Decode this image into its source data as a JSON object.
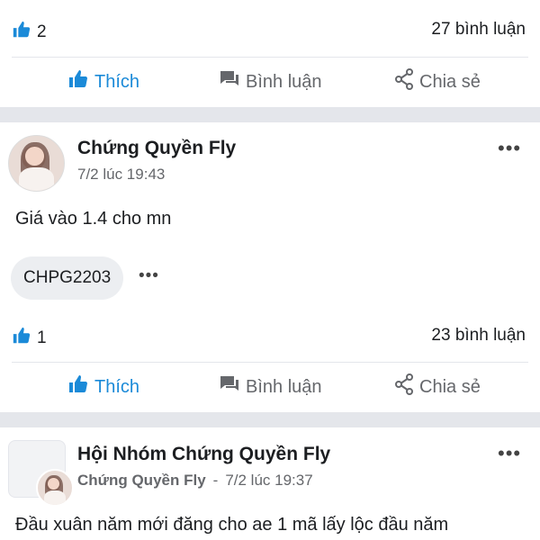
{
  "post1": {
    "like_count": "2",
    "comment_count": "27 bình luận",
    "actions": {
      "like": "Thích",
      "comment": "Bình luận",
      "share": "Chia sẻ"
    }
  },
  "post2": {
    "author": "Chứng Quyền Fly",
    "time": "7/2 lúc 19:43",
    "text": "Giá vào 1.4 cho mn",
    "tag": "CHPG2203",
    "more_dots": "•••",
    "chip_more": "•••",
    "like_count": "1",
    "comment_count": "23 bình luận",
    "actions": {
      "like": "Thích",
      "comment": "Bình luận",
      "share": "Chia sẻ"
    }
  },
  "post3": {
    "group_name": "Hội Nhóm Chứng Quyền Fly",
    "author": "Chứng Quyền Fly",
    "separator": "-",
    "time": "7/2 lúc 19:37",
    "more_dots": "•••",
    "text": "Đầu xuân năm mới đăng cho ae 1 mã lấy lộc đầu năm"
  },
  "icons": {
    "like": "thumbs-up-icon",
    "comment": "comment-icon",
    "share": "share-icon",
    "more": "more-horizontal-icon"
  },
  "colors": {
    "accent": "#1b8ad8",
    "muted": "#65676b",
    "separator": "#e4e6eb"
  }
}
